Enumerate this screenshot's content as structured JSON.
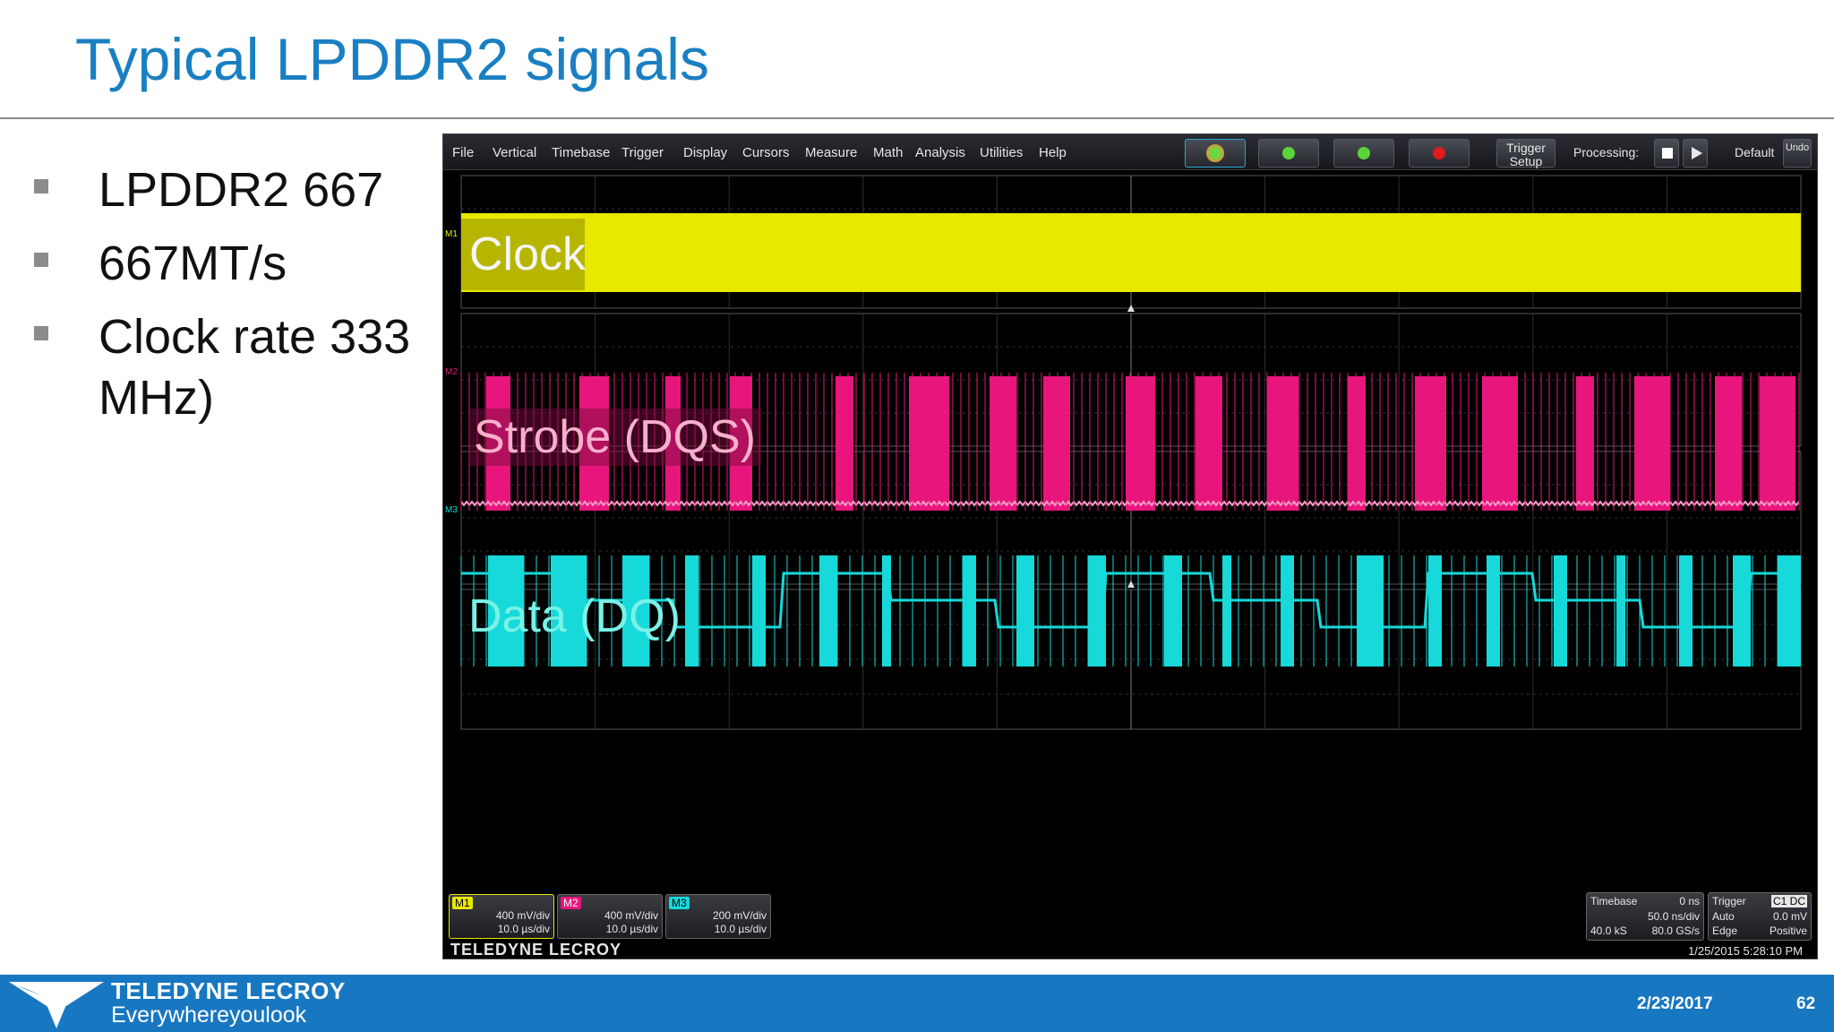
{
  "slide": {
    "title": "Typical LPDDR2 signals",
    "bullets": [
      "LPDDR2 667",
      "667MT/s",
      "Clock rate 333 MHz)"
    ]
  },
  "scope": {
    "menu": [
      "File",
      "Vertical",
      "Timebase",
      "Trigger",
      "Display",
      "Cursors",
      "Measure",
      "Math",
      "Analysis",
      "Utilities",
      "Help"
    ],
    "toolbar": {
      "trigger_setup": [
        "Trigger",
        "Setup"
      ],
      "processing_label": "Processing:",
      "default_label": "Default",
      "undo_label": "Undo"
    },
    "traces": [
      {
        "id": "M1",
        "label": "Clock",
        "color": "#e8e800"
      },
      {
        "id": "M2",
        "label": "Strobe (DQS)",
        "color": "#e8167c"
      },
      {
        "id": "M3",
        "label": "Data (DQ)",
        "color": "#17d9d9"
      }
    ],
    "channels": [
      {
        "tag": "M1",
        "vdiv": "400 mV/div",
        "tdiv": "10.0 µs/div",
        "color": "#e8e800"
      },
      {
        "tag": "M2",
        "vdiv": "400 mV/div",
        "tdiv": "10.0 µs/div",
        "color": "#e8167c"
      },
      {
        "tag": "M3",
        "vdiv": "200 mV/div",
        "tdiv": "10.0 µs/div",
        "color": "#17d9d9"
      }
    ],
    "timebase": {
      "label": "Timebase",
      "delay": "0 ns",
      "per_div": "50.0 ns/div",
      "samples": "40.0 kS",
      "rate": "80.0 GS/s"
    },
    "trigger": {
      "label": "Trigger",
      "coupling": "C1 DC",
      "mode": "Auto",
      "level": "0.0 mV",
      "type": "Edge",
      "slope": "Positive"
    },
    "brand": "TELEDYNE LECROY",
    "timestamp": "1/25/2015 5:28:10 PM"
  },
  "footer": {
    "brand": "TELEDYNE LECROY",
    "tagline": "Everywhereyoulook",
    "date": "2/23/2017",
    "page": "62"
  },
  "colors": {
    "title": "#1a7fc2",
    "footer": "#1877c1"
  }
}
